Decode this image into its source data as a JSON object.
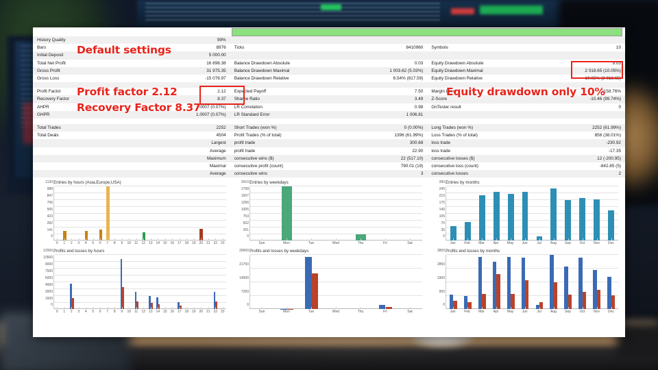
{
  "annotations": [
    {
      "id": "default-settings",
      "text": "Default settings"
    },
    {
      "id": "profit-factor",
      "text": "Profit factor 2.12"
    },
    {
      "id": "recovery-factor",
      "text": "Recovery Factor 8.37"
    },
    {
      "id": "equity-drawdown",
      "text": "Equity drawdown only 10%"
    }
  ],
  "accent_color": "#e8231b",
  "progress_bar_color": "#8ce07f",
  "stats": {
    "rows": [
      {
        "type": "data",
        "cells": [
          "History Quality",
          "99%",
          "",
          "",
          "",
          ""
        ]
      },
      {
        "type": "data",
        "cells": [
          "Bars",
          "8976",
          "Ticks",
          "8410960",
          "Symbols",
          "10"
        ]
      },
      {
        "type": "data",
        "cells": [
          "Initial Deposit",
          "5 000.00",
          "",
          "",
          "",
          ""
        ]
      },
      {
        "type": "data",
        "cells": [
          "Total Net Profit",
          "16 898.38",
          "Balance Drawdown Absolute",
          "0.03",
          "Equity Drawdown Absolute",
          "9.03"
        ]
      },
      {
        "type": "data",
        "cells": [
          "Gross Profit",
          "31 975.35",
          "Balance Drawdown Maximal",
          "1 003.62 (5.03%)",
          "Equity Drawdown Maximal",
          "2 018.65 (10.05%)"
        ]
      },
      {
        "type": "data",
        "cells": [
          "Gross Loss",
          "-15 076.97",
          "Balance Drawdown Relative",
          "6.54% (817.59)",
          "Equity Drawdown Relative",
          "10.05% (2 018.65)"
        ]
      },
      {
        "type": "blank",
        "cells": [
          "",
          "",
          "",
          "",
          "",
          ""
        ]
      },
      {
        "type": "data",
        "cells": [
          "Profit Factor",
          "2.12",
          "Expected Payoff",
          "7.50",
          "Margin Level",
          "2158.76%"
        ]
      },
      {
        "type": "data",
        "cells": [
          "Recovery Factor",
          "8.37",
          "Sharpe Ratio",
          "3.49",
          "Z-Score",
          "-10.46 (99.74%)"
        ]
      },
      {
        "type": "data",
        "cells": [
          "AHPR",
          "1.0007 (0.07%)",
          "LR Correlation",
          "0.98",
          "OnTester result",
          "0"
        ]
      },
      {
        "type": "data",
        "cells": [
          "GHPR",
          "1.0007 (0.07%)",
          "LR Standard Error",
          "1 006.81",
          "",
          ""
        ]
      },
      {
        "type": "blank",
        "cells": [
          "",
          "",
          "",
          "",
          "",
          ""
        ]
      },
      {
        "type": "data",
        "cells": [
          "Total Trades",
          "2252",
          "Short Trades (won %)",
          "0 (0.00%)",
          "Long Trades (won %)",
          "2252 (61.99%)"
        ]
      },
      {
        "type": "data",
        "cells": [
          "Total Deals",
          "4504",
          "Profit Trades (% of total)",
          "1396 (61.99%)",
          "Loss Trades (% of total)",
          "856 (38.01%)"
        ]
      },
      {
        "type": "data",
        "cells": [
          "",
          "Largest",
          "profit trade",
          "300.68",
          "loss trade",
          "-230.92"
        ]
      },
      {
        "type": "data",
        "cells": [
          "",
          "Average",
          "profit trade",
          "22.90",
          "loss trade",
          "-17.35"
        ]
      },
      {
        "type": "data",
        "cells": [
          "",
          "Maximum",
          "consecutive wins ($)",
          "22 (517.10)",
          "consecutive losses ($)",
          "12 (-200.95)"
        ]
      },
      {
        "type": "data",
        "cells": [
          "",
          "Maximal",
          "consecutive profit (count)",
          "790.01 (19)",
          "consecutive loss (count)",
          "-842.85 (5)"
        ]
      },
      {
        "type": "data",
        "cells": [
          "",
          "Average",
          "consecutive wins",
          "3",
          "consecutive losses",
          "2"
        ]
      }
    ]
  },
  "chart_data": [
    {
      "id": "entries-by-hours",
      "type": "bar",
      "title": "Entries by hours (Asia,Europe,USA)",
      "categories": [
        "0",
        "1",
        "2",
        "3",
        "4",
        "5",
        "6",
        "7",
        "8",
        "9",
        "10",
        "11",
        "12",
        "13",
        "14",
        "15",
        "16",
        "17",
        "18",
        "19",
        "20",
        "21",
        "22",
        "23"
      ],
      "values": [
        0,
        212,
        0,
        0,
        200,
        0,
        240,
        1130,
        0,
        0,
        0,
        0,
        175,
        0,
        0,
        0,
        0,
        0,
        0,
        0,
        250,
        0,
        0,
        0
      ],
      "colors": [
        "#c8820f",
        "#c8820f",
        "#c8820f",
        "#c8820f",
        "#c8820f",
        "#c8820f",
        "#c8820f",
        "#e8b552",
        "#c8820f",
        "#c8820f",
        "#c8820f",
        "#c8820f",
        "#2e9b4f",
        "#c8820f",
        "#c8820f",
        "#c8820f",
        "#c8820f",
        "#c8820f",
        "#c8820f",
        "#c8820f",
        "#a83a20",
        "#c8820f",
        "#c8820f",
        "#c8820f"
      ],
      "yticks": [
        0,
        141,
        282,
        423,
        565,
        706,
        847,
        988,
        1130
      ],
      "ylim": [
        0,
        1130
      ],
      "xlabel": "",
      "ylabel": "",
      "grid": true,
      "legend": "none"
    },
    {
      "id": "entries-by-weekdays",
      "type": "bar",
      "title": "Entries by weekdays",
      "categories": [
        "Sun",
        "Mon",
        "Tue",
        "Wed",
        "Thu",
        "Fri",
        "Sat"
      ],
      "values": [
        0,
        2010,
        0,
        0,
        251,
        0,
        0
      ],
      "colors": [
        "#4aa87a",
        "#4aa87a",
        "#4aa87a",
        "#4aa87a",
        "#4aa87a",
        "#4aa87a",
        "#4aa87a"
      ],
      "yticks": [
        0,
        251,
        502,
        753,
        1005,
        1256,
        1507,
        1758,
        2010
      ],
      "ylim": [
        0,
        2010
      ],
      "xlabel": "",
      "ylabel": "",
      "grid": true,
      "legend": "none"
    },
    {
      "id": "entries-by-months",
      "type": "bar",
      "title": "Entries by months",
      "categories": [
        "Jan",
        "Feb",
        "Mar",
        "Apr",
        "May",
        "Jun",
        "Jul",
        "Aug",
        "Sep",
        "Oct",
        "Nov",
        "Dec"
      ],
      "values": [
        77,
        96,
        235,
        254,
        243,
        252,
        22,
        270,
        210,
        221,
        216,
        156
      ],
      "colors": [
        "#2e8fb5",
        "#2e8fb5",
        "#2e8fb5",
        "#2e8fb5",
        "#2e8fb5",
        "#2e8fb5",
        "#2e8fb5",
        "#2e8fb5",
        "#2e8fb5",
        "#2e8fb5",
        "#2e8fb5",
        "#2e8fb5"
      ],
      "yticks": [
        0,
        35,
        70,
        105,
        140,
        175,
        210,
        245,
        280
      ],
      "ylim": [
        0,
        280
      ],
      "xlabel": "",
      "ylabel": "",
      "grid": true,
      "legend": "none"
    },
    {
      "id": "profits-and-losses-by-hours",
      "type": "bar",
      "title": "Profits and losses by hours",
      "categories": [
        "0",
        "1",
        "2",
        "3",
        "4",
        "5",
        "6",
        "7",
        "8",
        "9",
        "10",
        "11",
        "12",
        "13",
        "14",
        "15",
        "16",
        "17",
        "18",
        "19",
        "20",
        "21",
        "22",
        "23"
      ],
      "series": [
        {
          "name": "profits",
          "color": "#3b6ab5",
          "values": [
            0,
            0,
            5700,
            0,
            0,
            0,
            0,
            0,
            0,
            11200,
            0,
            3900,
            0,
            2900,
            2600,
            0,
            0,
            1550,
            0,
            0,
            0,
            0,
            3850,
            0
          ]
        },
        {
          "name": "losses",
          "color": "#b8432a",
          "values": [
            0,
            0,
            2500,
            0,
            0,
            0,
            0,
            0,
            0,
            5000,
            0,
            1800,
            0,
            1400,
            1100,
            0,
            0,
            800,
            0,
            0,
            0,
            0,
            1800,
            0
          ]
        }
      ],
      "yticks": [
        0,
        1500,
        3000,
        4500,
        6000,
        7500,
        9000,
        10500,
        12000
      ],
      "ylim": [
        0,
        12000
      ],
      "xlabel": "",
      "ylabel": "",
      "grid": true,
      "legend": "none"
    },
    {
      "id": "profits-and-losses-by-weekdays",
      "type": "bar",
      "title": "Profits and losses by weekdays",
      "categories": [
        "Sun",
        "Mon",
        "Tue",
        "Wed",
        "Thu",
        "Fri",
        "Sat"
      ],
      "series": [
        {
          "name": "profits",
          "color": "#3b6ab5",
          "values": [
            0,
            250,
            28200,
            0,
            0,
            2400,
            0
          ]
        },
        {
          "name": "losses",
          "color": "#b8432a",
          "values": [
            0,
            120,
            19400,
            0,
            0,
            1100,
            0
          ]
        }
      ],
      "yticks": [
        0,
        7250,
        14500,
        21750,
        29000
      ],
      "ylim": [
        0,
        29000
      ],
      "xlabel": "",
      "ylabel": "",
      "grid": true,
      "legend": "none"
    },
    {
      "id": "profits-and-losses-by-months",
      "type": "bar",
      "title": "Profits and losses by months",
      "categories": [
        "Jan",
        "Feb",
        "Mar",
        "Apr",
        "May",
        "Jun",
        "Jul",
        "Aug",
        "Sep",
        "Oct",
        "Nov",
        "Dec"
      ],
      "series": [
        {
          "name": "profits",
          "color": "#3b6ab5",
          "values": [
            1030,
            940,
            3700,
            3330,
            3680,
            3640,
            330,
            3800,
            3000,
            3620,
            2760,
            2300
          ]
        },
        {
          "name": "losses",
          "color": "#b8432a",
          "values": [
            580,
            500,
            1080,
            2480,
            1080,
            2050,
            500,
            1900,
            1030,
            1230,
            1350,
            1000
          ]
        }
      ],
      "yticks": [
        0,
        950,
        1900,
        2850,
        3800
      ],
      "ylim": [
        0,
        3800
      ],
      "xlabel": "",
      "ylabel": "",
      "grid": true,
      "legend": "none"
    }
  ]
}
